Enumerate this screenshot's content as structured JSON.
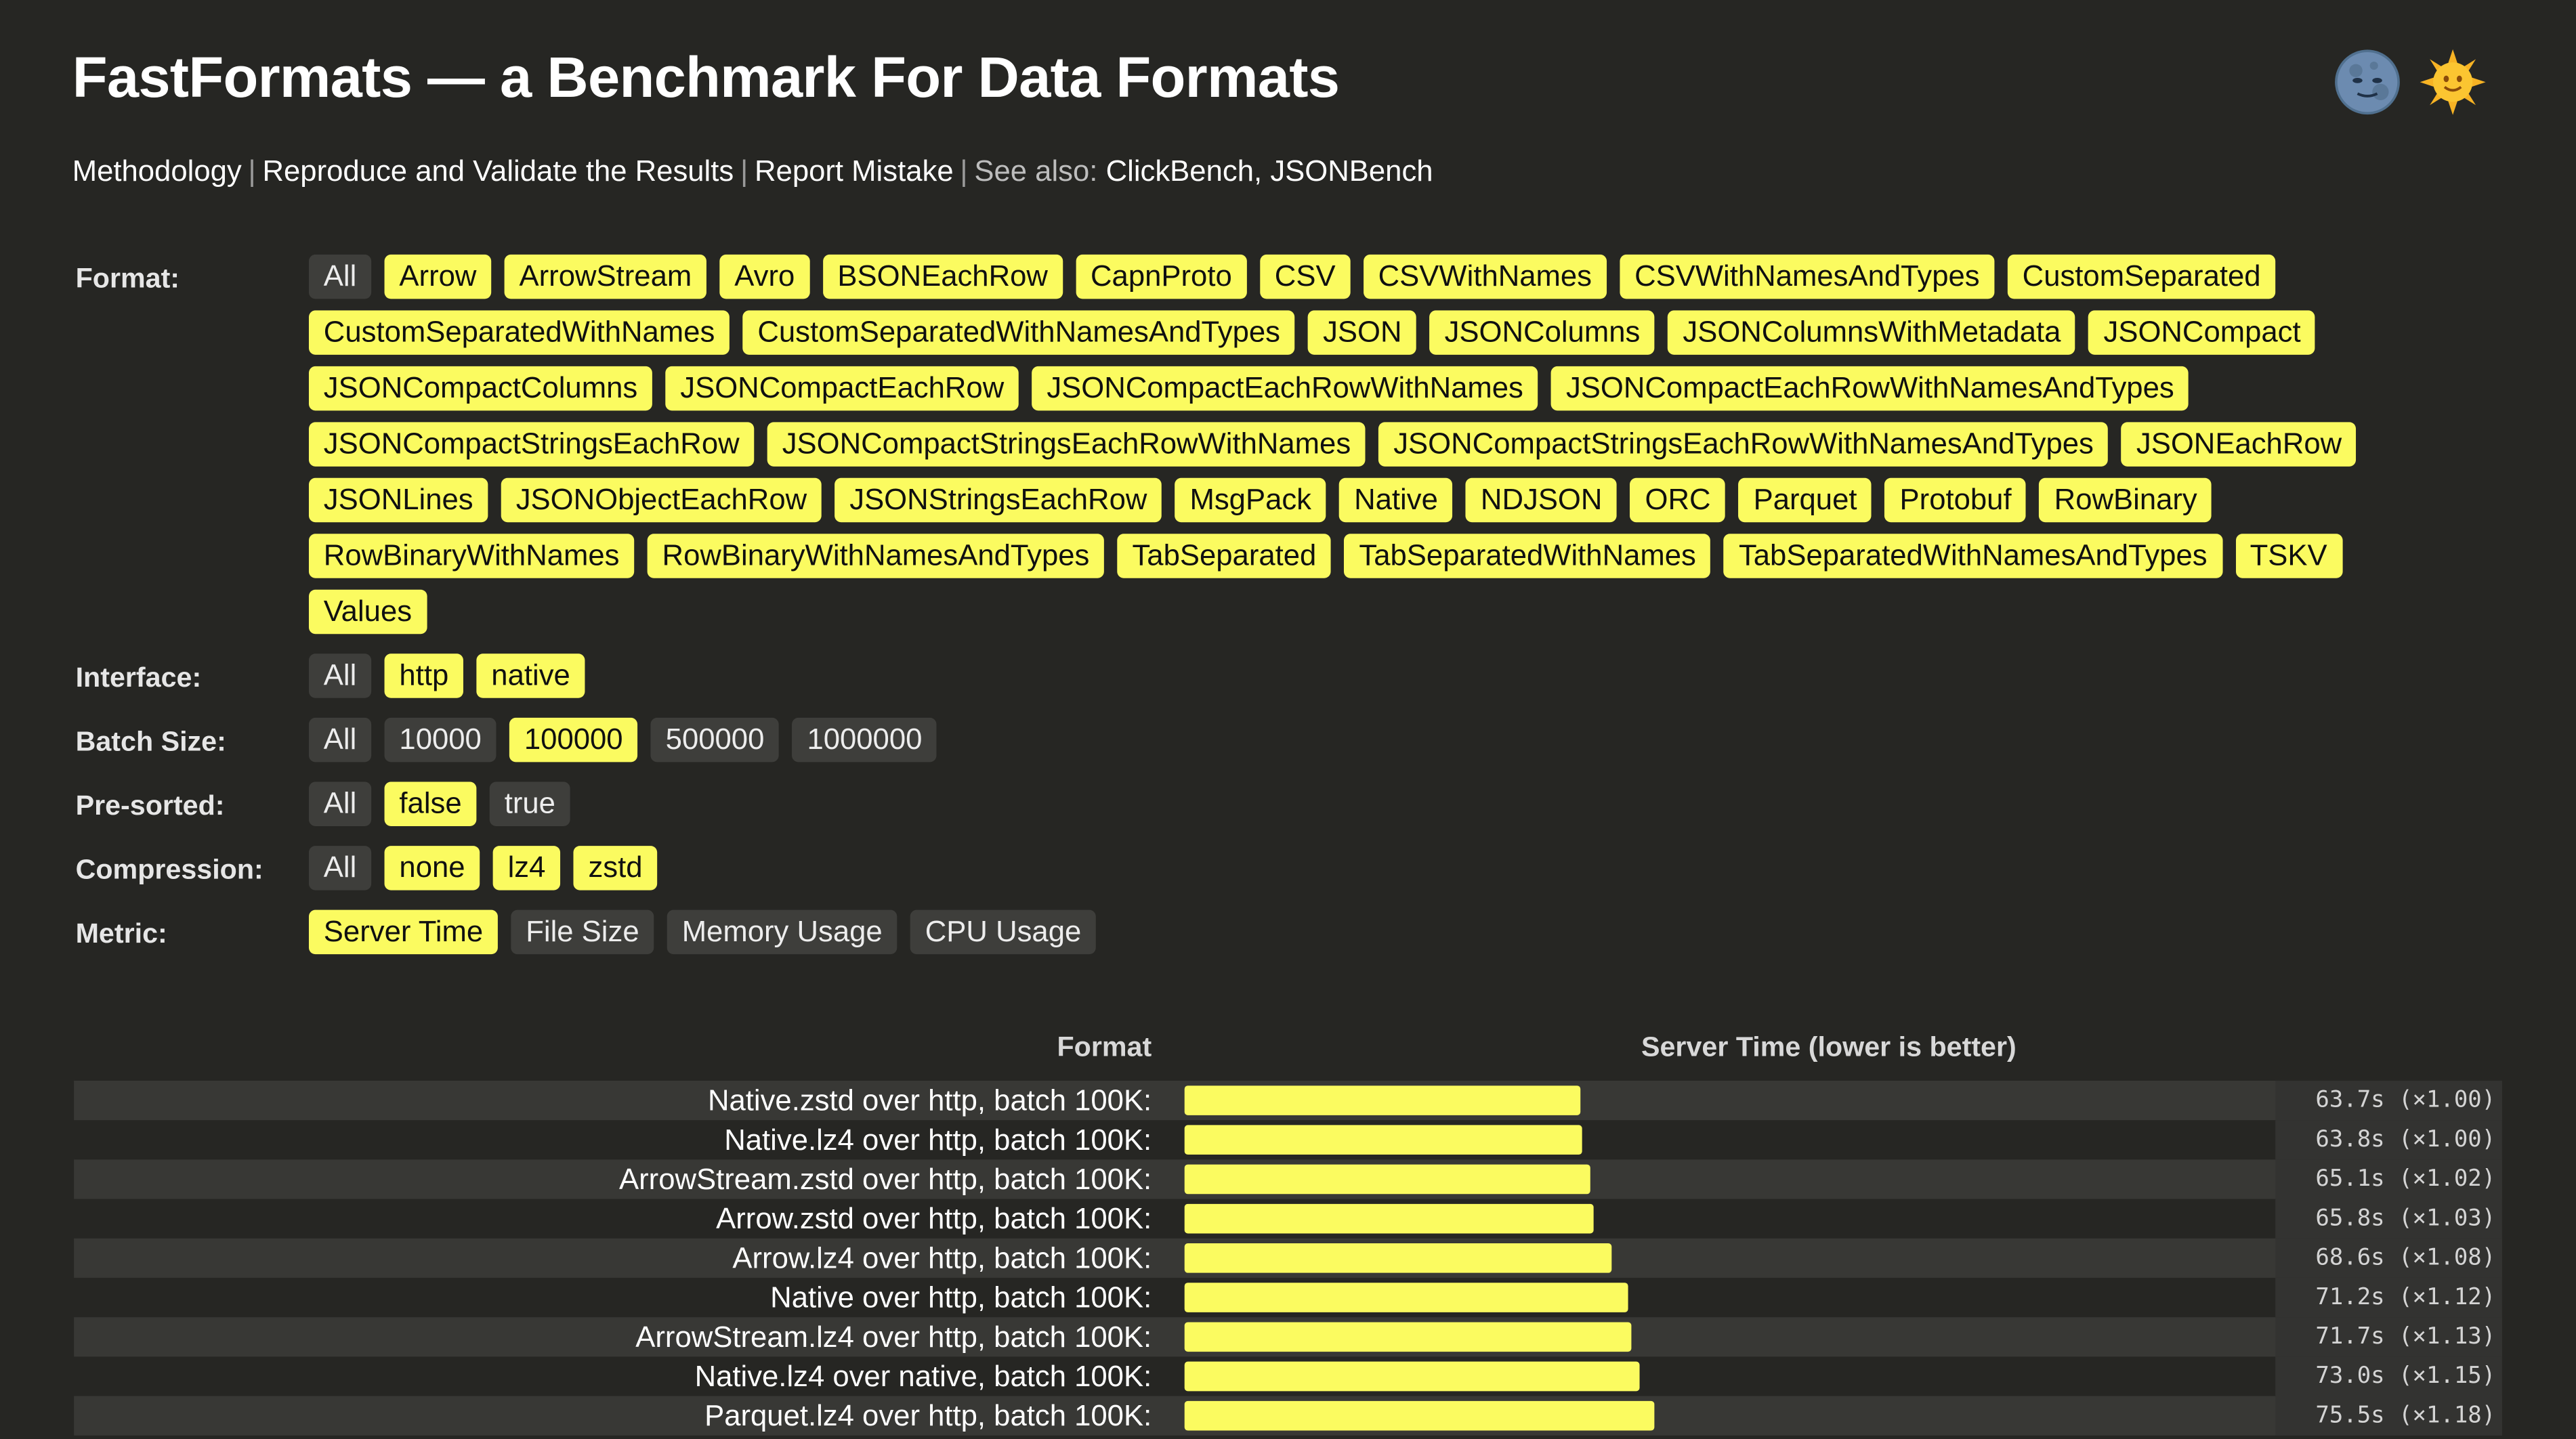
{
  "title": "FastFormats — a Benchmark For Data Formats",
  "theme": {
    "dark_icon": "moon-face-icon",
    "light_icon": "sun-face-icon"
  },
  "nav": {
    "methodology": "Methodology",
    "reproduce": "Reproduce and Validate the Results",
    "report": "Report Mistake",
    "see_also_label": "See also:",
    "clickbench": "ClickBench",
    "jsonbench": "JSONBench",
    "separator": "|",
    "comma": ","
  },
  "filters": [
    {
      "label": "Format:",
      "options": [
        {
          "text": "All",
          "selected": false
        },
        {
          "text": "Arrow",
          "selected": true
        },
        {
          "text": "ArrowStream",
          "selected": true
        },
        {
          "text": "Avro",
          "selected": true
        },
        {
          "text": "BSONEachRow",
          "selected": true
        },
        {
          "text": "CapnProto",
          "selected": true
        },
        {
          "text": "CSV",
          "selected": true
        },
        {
          "text": "CSVWithNames",
          "selected": true
        },
        {
          "text": "CSVWithNamesAndTypes",
          "selected": true
        },
        {
          "text": "CustomSeparated",
          "selected": true
        },
        {
          "text": "CustomSeparatedWithNames",
          "selected": true
        },
        {
          "text": "CustomSeparatedWithNamesAndTypes",
          "selected": true
        },
        {
          "text": "JSON",
          "selected": true
        },
        {
          "text": "JSONColumns",
          "selected": true
        },
        {
          "text": "JSONColumnsWithMetadata",
          "selected": true
        },
        {
          "text": "JSONCompact",
          "selected": true
        },
        {
          "text": "JSONCompactColumns",
          "selected": true
        },
        {
          "text": "JSONCompactEachRow",
          "selected": true
        },
        {
          "text": "JSONCompactEachRowWithNames",
          "selected": true
        },
        {
          "text": "JSONCompactEachRowWithNamesAndTypes",
          "selected": true
        },
        {
          "text": "JSONCompactStringsEachRow",
          "selected": true
        },
        {
          "text": "JSONCompactStringsEachRowWithNames",
          "selected": true
        },
        {
          "text": "JSONCompactStringsEachRowWithNamesAndTypes",
          "selected": true
        },
        {
          "text": "JSONEachRow",
          "selected": true
        },
        {
          "text": "JSONLines",
          "selected": true
        },
        {
          "text": "JSONObjectEachRow",
          "selected": true
        },
        {
          "text": "JSONStringsEachRow",
          "selected": true
        },
        {
          "text": "MsgPack",
          "selected": true
        },
        {
          "text": "Native",
          "selected": true
        },
        {
          "text": "NDJSON",
          "selected": true
        },
        {
          "text": "ORC",
          "selected": true
        },
        {
          "text": "Parquet",
          "selected": true
        },
        {
          "text": "Protobuf",
          "selected": true
        },
        {
          "text": "RowBinary",
          "selected": true
        },
        {
          "text": "RowBinaryWithNames",
          "selected": true
        },
        {
          "text": "RowBinaryWithNamesAndTypes",
          "selected": true
        },
        {
          "text": "TabSeparated",
          "selected": true
        },
        {
          "text": "TabSeparatedWithNames",
          "selected": true
        },
        {
          "text": "TabSeparatedWithNamesAndTypes",
          "selected": true
        },
        {
          "text": "TSKV",
          "selected": true
        },
        {
          "text": "Values",
          "selected": true
        }
      ]
    },
    {
      "label": "Interface:",
      "options": [
        {
          "text": "All",
          "selected": false
        },
        {
          "text": "http",
          "selected": true
        },
        {
          "text": "native",
          "selected": true
        }
      ]
    },
    {
      "label": "Batch Size:",
      "options": [
        {
          "text": "All",
          "selected": false
        },
        {
          "text": "10000",
          "selected": false
        },
        {
          "text": "100000",
          "selected": true
        },
        {
          "text": "500000",
          "selected": false
        },
        {
          "text": "1000000",
          "selected": false
        }
      ]
    },
    {
      "label": "Pre-sorted:",
      "options": [
        {
          "text": "All",
          "selected": false
        },
        {
          "text": "false",
          "selected": true
        },
        {
          "text": "true",
          "selected": false
        }
      ]
    },
    {
      "label": "Compression:",
      "options": [
        {
          "text": "All",
          "selected": false
        },
        {
          "text": "none",
          "selected": true
        },
        {
          "text": "lz4",
          "selected": true
        },
        {
          "text": "zstd",
          "selected": true
        }
      ]
    },
    {
      "label": "Metric:",
      "options": [
        {
          "text": "Server Time",
          "selected": true
        },
        {
          "text": "File Size",
          "selected": false
        },
        {
          "text": "Memory Usage",
          "selected": false
        },
        {
          "text": "CPU Usage",
          "selected": false
        }
      ]
    }
  ],
  "table": {
    "format_header": "Format",
    "metric_header": "Server Time (lower is better)"
  },
  "colors": {
    "background": "#262623",
    "accent": "#fbfb60",
    "chip_inactive": "#3e3e3b",
    "row_stripe": "#383835"
  },
  "chart_data": {
    "type": "bar",
    "orientation": "horizontal",
    "title": "Server Time (lower is better)",
    "categories": [
      "Native.zstd over http, batch 100K:",
      "Native.lz4 over http, batch 100K:",
      "ArrowStream.zstd over http, batch 100K:",
      "Arrow.zstd over http, batch 100K:",
      "Arrow.lz4 over http, batch 100K:",
      "Native over http, batch 100K:",
      "ArrowStream.lz4 over http, batch 100K:",
      "Native.lz4 over native, batch 100K:",
      "Parquet.lz4 over http, batch 100K:"
    ],
    "values": [
      63.7,
      63.8,
      65.1,
      65.8,
      68.6,
      71.2,
      71.7,
      73.0,
      75.5
    ],
    "value_labels": [
      "63.7s (×1.00)",
      "63.8s (×1.00)",
      "65.1s (×1.02)",
      "65.8s (×1.03)",
      "68.6s (×1.08)",
      "71.2s (×1.12)",
      "71.7s (×1.13)",
      "73.0s (×1.15)",
      "75.5s (×1.18)"
    ],
    "unit": "s"
  }
}
